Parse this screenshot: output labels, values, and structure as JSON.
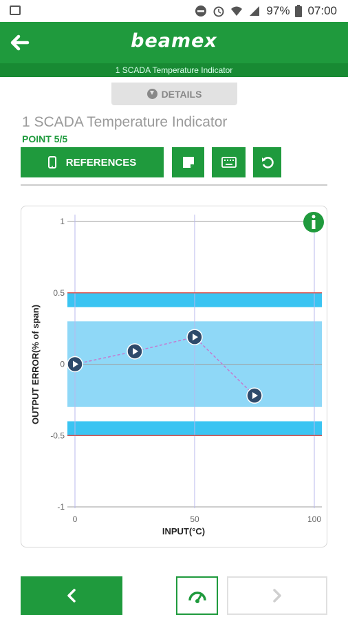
{
  "status_bar": {
    "battery": "97%",
    "time": "07:00"
  },
  "header": {
    "brand": "beamex",
    "subtitle": "1 SCADA Temperature Indicator"
  },
  "details_tab": {
    "label": "DETAILS"
  },
  "instrument": {
    "title": "1 SCADA Temperature Indicator",
    "point": "POINT 5/5"
  },
  "toolbar": {
    "references_label": "REFERENCES"
  },
  "colors": {
    "green": "#1f9a3d",
    "band_light": "#8fd8f7",
    "band_strong": "#3ac4f2",
    "limit_line": "#d9534f",
    "point_fill": "#2e4a6b",
    "connector": "#c47ad0"
  },
  "chart_data": {
    "type": "scatter",
    "xlabel": "INPUT(°C)",
    "ylabel": "OUTPUT ERROR(% of span)",
    "xlim": [
      0,
      100
    ],
    "ylim": [
      -1,
      1
    ],
    "x_ticks": [
      "0",
      "50",
      "100"
    ],
    "y_ticks": [
      "1",
      "0.5",
      "0",
      "-0.5",
      "-1"
    ],
    "points": [
      {
        "x": 0,
        "y": 0.0
      },
      {
        "x": 25,
        "y": 0.09
      },
      {
        "x": 50,
        "y": 0.19
      },
      {
        "x": 75,
        "y": -0.22
      }
    ],
    "inner_band": [
      -0.3,
      0.3
    ],
    "outer_bands": [
      [
        0.4,
        0.5
      ],
      [
        -0.5,
        -0.4
      ]
    ],
    "limit_lines": [
      0.5,
      -0.5
    ]
  }
}
